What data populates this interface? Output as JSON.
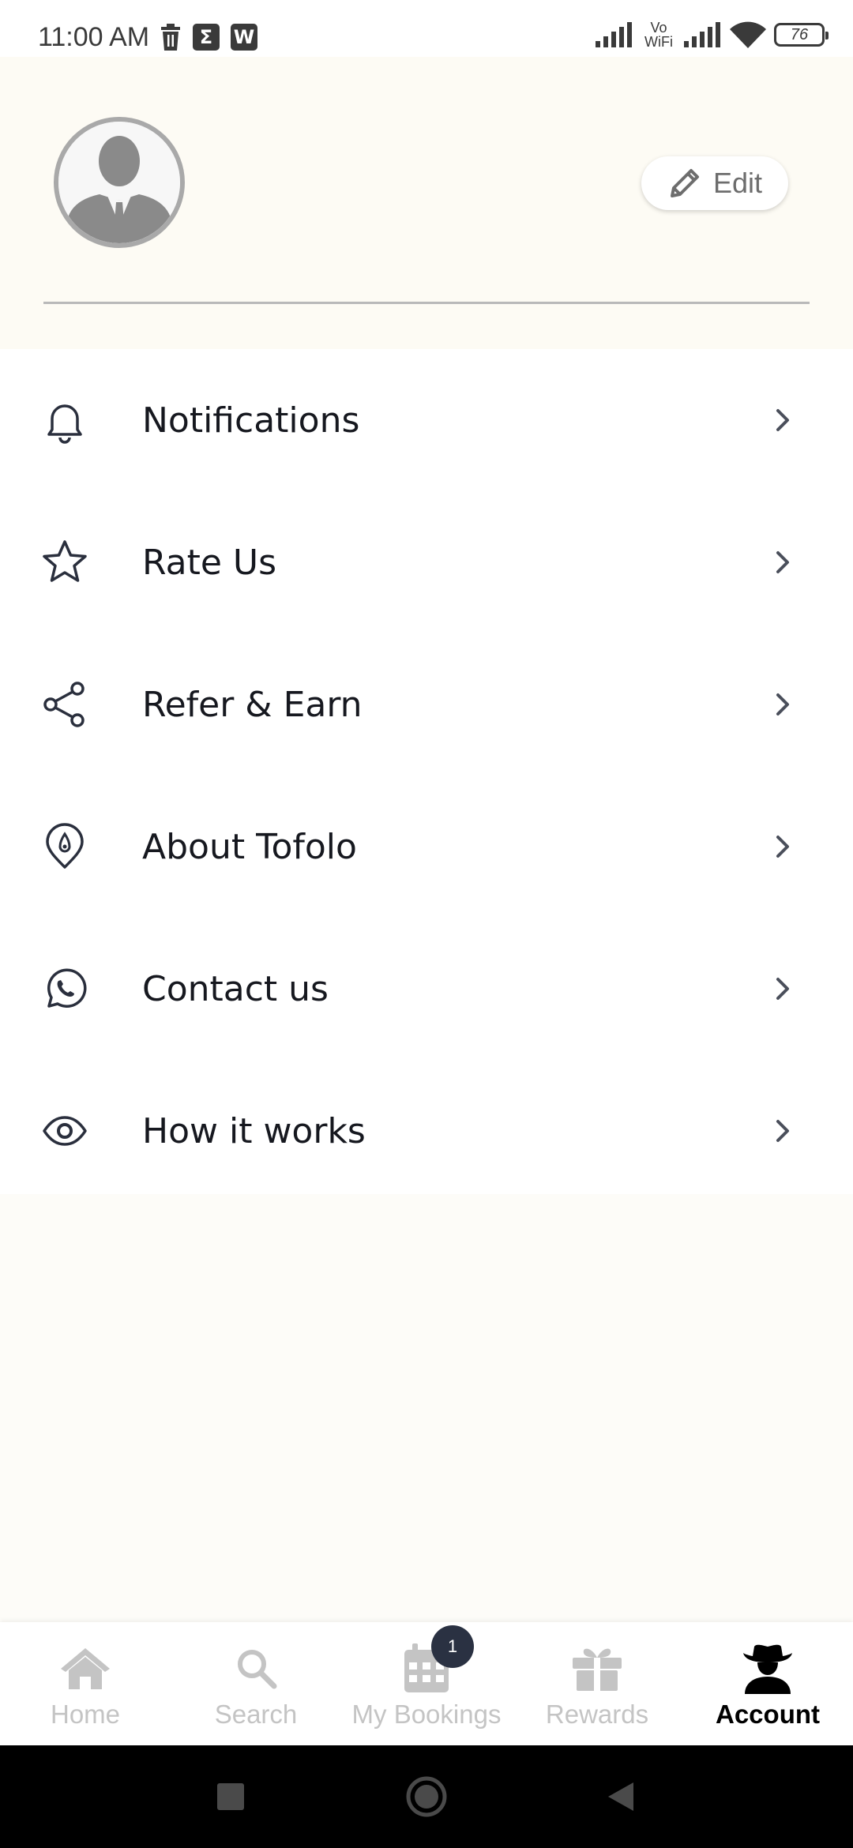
{
  "status_bar": {
    "time": "11:00 AM",
    "vowifi_line1": "Vo",
    "vowifi_line2": "WiFi",
    "battery": "76",
    "icons": [
      "trash-icon",
      "sigma-icon",
      "w-app-icon",
      "signal-icon",
      "vowifi-icon",
      "signal-icon",
      "wifi-icon",
      "battery-icon"
    ]
  },
  "profile": {
    "edit_label": "Edit"
  },
  "menu": {
    "items": [
      {
        "label": "Notifications",
        "icon": "bell-icon"
      },
      {
        "label": "Rate Us",
        "icon": "star-icon"
      },
      {
        "label": "Refer & Earn",
        "icon": "share-icon"
      },
      {
        "label": "About Tofolo",
        "icon": "location-pin-icon"
      },
      {
        "label": "Contact us",
        "icon": "whatsapp-icon"
      },
      {
        "label": "How it works",
        "icon": "eye-icon"
      }
    ]
  },
  "bottom_nav": {
    "items": [
      {
        "label": "Home",
        "icon": "home-icon",
        "active": false
      },
      {
        "label": "Search",
        "icon": "search-icon",
        "active": false
      },
      {
        "label": "My Bookings",
        "icon": "calendar-icon",
        "active": false
      },
      {
        "label": "Rewards",
        "icon": "gift-icon",
        "active": false
      },
      {
        "label": "Account",
        "icon": "cowboy-user-icon",
        "active": true
      }
    ],
    "bookings_badge": "1"
  },
  "colors": {
    "header_bg": "#fdfbf4",
    "text": "#16181f",
    "inactive_nav": "#c4c4c4",
    "badge_bg": "#2a3142"
  }
}
